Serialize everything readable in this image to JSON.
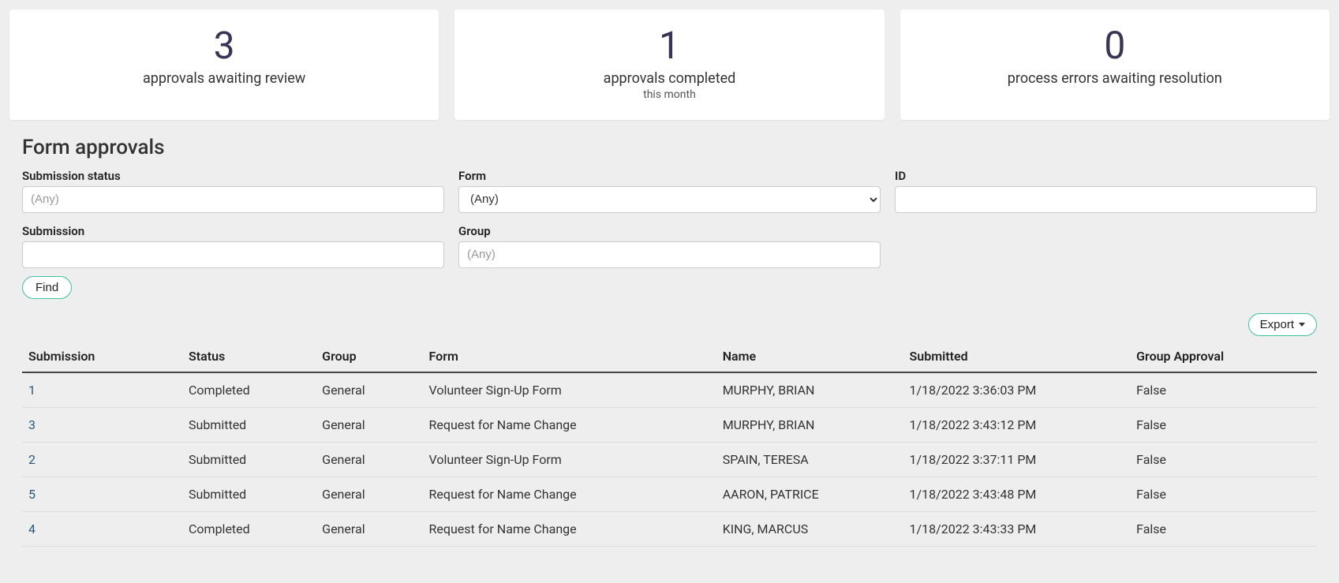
{
  "stats": [
    {
      "value": "3",
      "label": "approvals awaiting review",
      "sub": ""
    },
    {
      "value": "1",
      "label": "approvals completed",
      "sub": "this month"
    },
    {
      "value": "0",
      "label": "process errors awaiting resolution",
      "sub": ""
    }
  ],
  "section_title": "Form approvals",
  "filters": {
    "submission_status": {
      "label": "Submission status",
      "placeholder": "(Any)"
    },
    "form": {
      "label": "Form",
      "selected": "(Any)"
    },
    "id": {
      "label": "ID"
    },
    "submission": {
      "label": "Submission"
    },
    "group": {
      "label": "Group",
      "placeholder": "(Any)"
    }
  },
  "buttons": {
    "find": "Find",
    "export": "Export"
  },
  "table": {
    "headers": {
      "submission": "Submission",
      "status": "Status",
      "group": "Group",
      "form": "Form",
      "name": "Name",
      "submitted": "Submitted",
      "group_approval": "Group Approval"
    },
    "rows": [
      {
        "submission": "1",
        "status": "Completed",
        "group": "General",
        "form": "Volunteer Sign-Up Form",
        "name": "MURPHY, BRIAN",
        "submitted": "1/18/2022 3:36:03 PM",
        "group_approval": "False"
      },
      {
        "submission": "3",
        "status": "Submitted",
        "group": "General",
        "form": "Request for Name Change",
        "name": "MURPHY, BRIAN",
        "submitted": "1/18/2022 3:43:12 PM",
        "group_approval": "False"
      },
      {
        "submission": "2",
        "status": "Submitted",
        "group": "General",
        "form": "Volunteer Sign-Up Form",
        "name": "SPAIN, TERESA",
        "submitted": "1/18/2022 3:37:11 PM",
        "group_approval": "False"
      },
      {
        "submission": "5",
        "status": "Submitted",
        "group": "General",
        "form": "Request for Name Change",
        "name": "AARON, PATRICE",
        "submitted": "1/18/2022 3:43:48 PM",
        "group_approval": "False"
      },
      {
        "submission": "4",
        "status": "Completed",
        "group": "General",
        "form": "Request for Name Change",
        "name": "KING, MARCUS",
        "submitted": "1/18/2022 3:43:33 PM",
        "group_approval": "False"
      }
    ]
  }
}
